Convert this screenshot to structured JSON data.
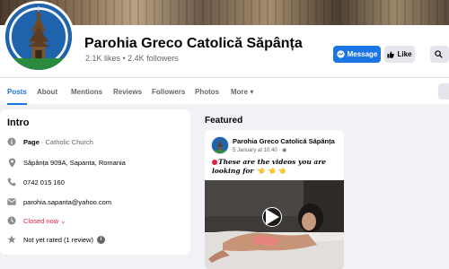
{
  "page": {
    "name": "Parohia Greco Catolică Săpânța",
    "stats": "2.1K likes • 2.4K followers"
  },
  "actions": {
    "message_label": "Message",
    "like_label": "Like"
  },
  "tabs": [
    {
      "label": "Posts",
      "active": true
    },
    {
      "label": "About"
    },
    {
      "label": "Mentions"
    },
    {
      "label": "Reviews"
    },
    {
      "label": "Followers"
    },
    {
      "label": "Photos"
    },
    {
      "label": "More ▾"
    }
  ],
  "intro": {
    "title": "Intro",
    "category_prefix": "Page",
    "category": " · Catholic Church",
    "address": "Săpânța 909A, Sapanta, Romania",
    "phone": "0742 015 160",
    "email": "parohia.sapanta@yahoo.com",
    "hours": "Closed now ⌄",
    "rating": "Not yet rated (1 review)"
  },
  "featured": {
    "title": "Featured",
    "post": {
      "author": "Parohia Greco Catolică Săpânța",
      "meta": "5 January at 10:40 · ◉",
      "text": "These are the videos you are looking for 👈 👈 👈"
    }
  },
  "colors": {
    "accent": "#1b74e4",
    "closed": "#e41e3f",
    "muted": "#65676b"
  },
  "icons": [
    "info-icon",
    "pin-icon",
    "phone-icon",
    "mail-icon",
    "clock-icon",
    "star-icon",
    "messenger-icon",
    "like-icon",
    "search-icon",
    "play-icon"
  ]
}
